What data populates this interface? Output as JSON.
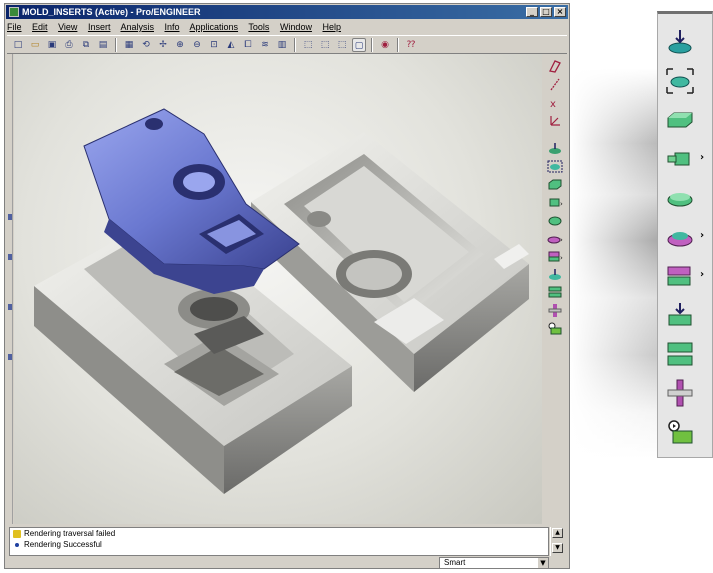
{
  "window": {
    "title": "MOLD_INSERTS (Active) - Pro/ENGINEER",
    "controls": [
      "_",
      "□",
      "×"
    ]
  },
  "menu": [
    "File",
    "Edit",
    "View",
    "Insert",
    "Analysis",
    "Info",
    "Applications",
    "Tools",
    "Window",
    "Help"
  ],
  "toolbar_icons": [
    "new-icon",
    "open-icon",
    "save-icon",
    "print-icon",
    "copy-icon",
    "paste-icon",
    "repaint-icon",
    "spin-icon",
    "orient-icon",
    "zoom-in-icon",
    "zoom-out-icon",
    "refit-icon",
    "view-icon",
    "saved-views-icon",
    "layers-icon",
    "model-tree-icon",
    "wireframe-icon",
    "hidden-line-icon",
    "no-hidden-icon",
    "shaded-icon",
    "datum-display-icon",
    "whats-this-icon"
  ],
  "right_toolbar_icons": [
    "datum-plane-icon",
    "datum-axis-icon",
    "datum-point-icon",
    "coordinate-system-icon",
    "refpart-icon",
    "workpiece-icon",
    "box-icon",
    "slider-icon",
    "volume-icon",
    "parting-surface-icon",
    "split-icon",
    "extract-icon",
    "mold-opening-icon",
    "trim-icon",
    "assembly-icon"
  ],
  "messages": [
    {
      "text": "Rendering traversal failed",
      "status": "warning"
    },
    {
      "text": "Rendering Successful",
      "status": "info"
    }
  ],
  "status": {
    "filter": "Smart"
  },
  "zoom_panel_icons": [
    {
      "name": "locate-refpart-icon",
      "has_flyout": false
    },
    {
      "name": "automatic-workpiece-icon",
      "has_flyout": false
    },
    {
      "name": "create-box-icon",
      "has_flyout": false
    },
    {
      "name": "slider-icon",
      "has_flyout": true
    },
    {
      "name": "volume-block-icon",
      "has_flyout": false
    },
    {
      "name": "parting-surface-icon",
      "has_flyout": true
    },
    {
      "name": "volume-split-icon",
      "has_flyout": true
    },
    {
      "name": "extract-mold-volume-icon",
      "has_flyout": false
    },
    {
      "name": "mold-opening-icon",
      "has_flyout": false
    },
    {
      "name": "ejector-pin-icon",
      "has_flyout": false
    },
    {
      "name": "mold-layout-icon",
      "has_flyout": false
    }
  ],
  "colors": {
    "title_bar": "#0a246a",
    "core_part": "#6a78d0",
    "mold_base": "#c8c8c4"
  }
}
